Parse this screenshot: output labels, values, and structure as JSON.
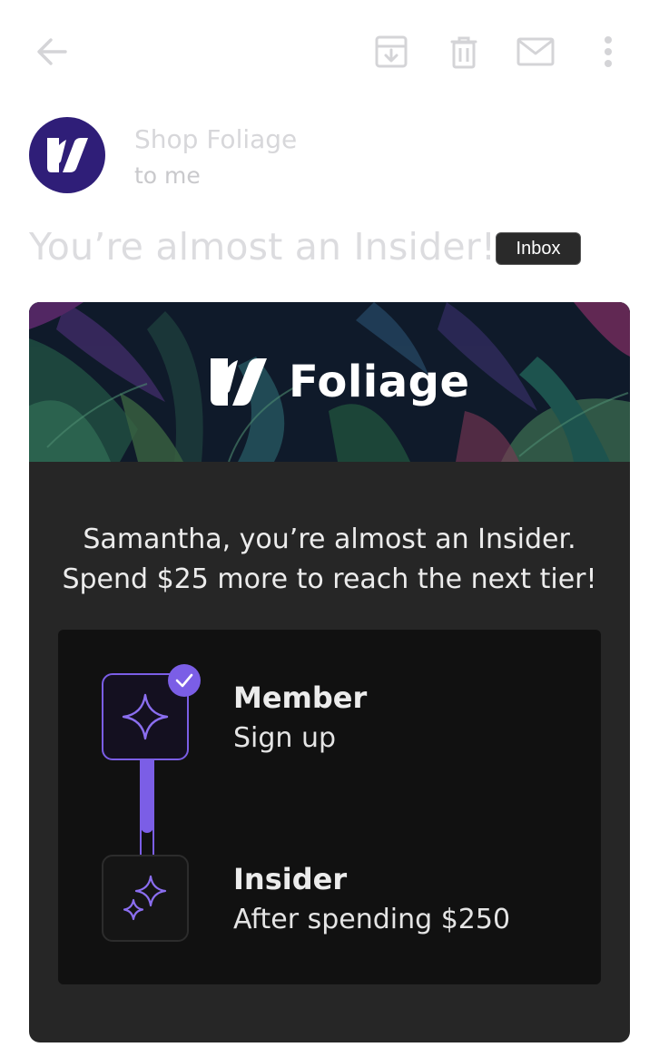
{
  "toolbar": {
    "icons": [
      "back-arrow-icon",
      "archive-icon",
      "trash-icon",
      "mail-icon",
      "more-vert-icon"
    ]
  },
  "email": {
    "sender_name": "Shop Foliage",
    "recipient_line": "to me",
    "subject": "You’re almost an Insider!",
    "label_badge": "Inbox"
  },
  "body": {
    "brand_name": "Foliage",
    "message_line1": "Samantha, you’re almost an Insider.",
    "message_line2": "Spend $25 more to reach the next tier!",
    "tiers": [
      {
        "name": "Member",
        "description": "Sign up",
        "completed": true
      },
      {
        "name": "Insider",
        "description": "After spending $250",
        "completed": false
      }
    ],
    "progress_to_next_tier": 0.77
  },
  "colors": {
    "accent": "#7b5ee6",
    "avatar_bg": "#2f1e78",
    "card_bg": "#262626",
    "panel_bg": "#111111"
  }
}
